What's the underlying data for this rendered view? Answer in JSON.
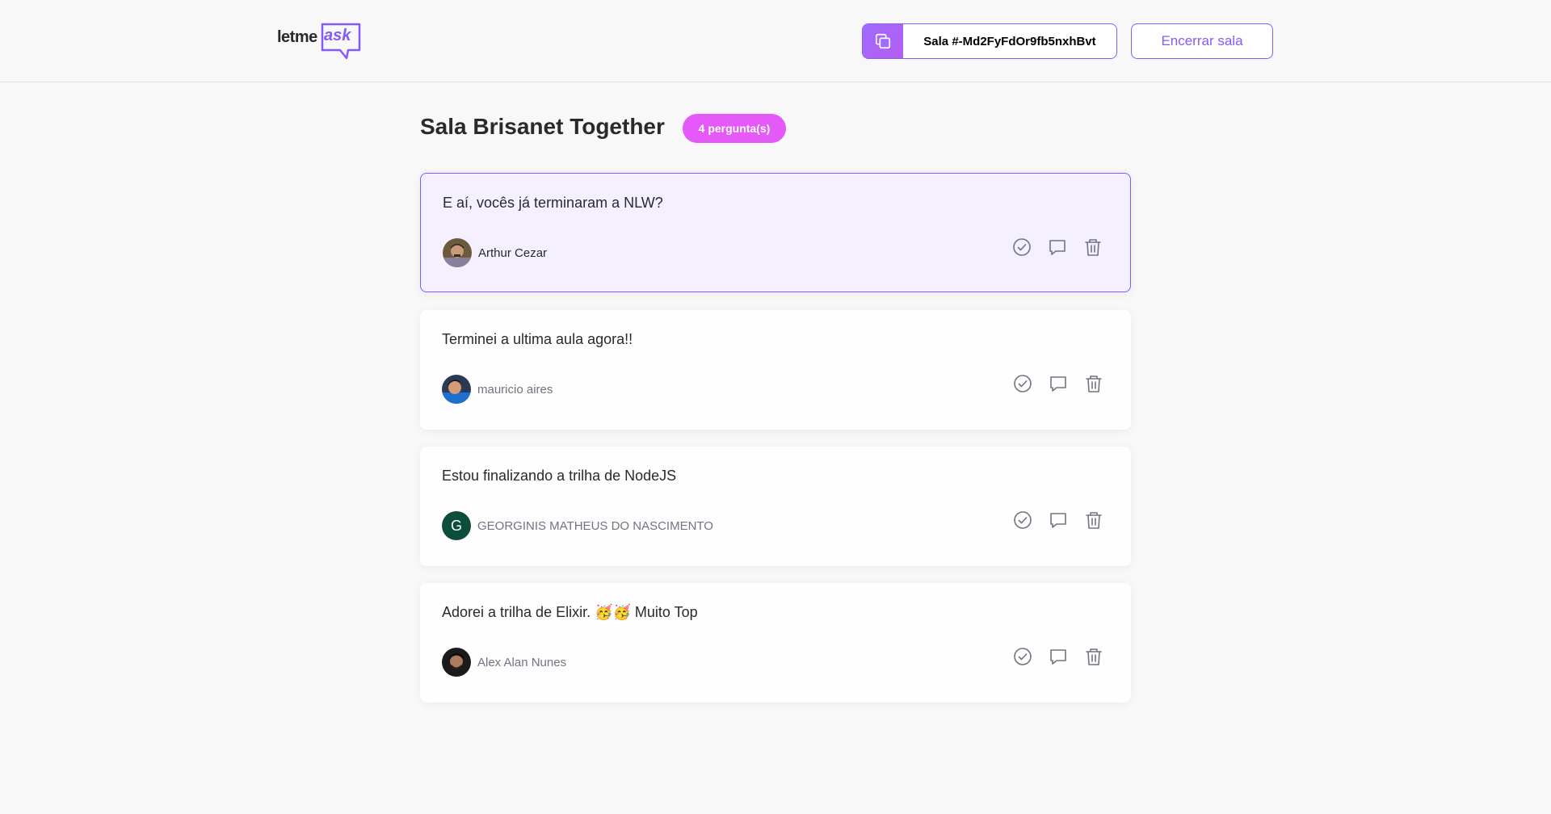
{
  "header": {
    "logo": {
      "part1": "letme",
      "part2": "ask"
    },
    "room_code_label": "Sala #-Md2FyFdOr9fb5nxhBvt",
    "end_room_label": "Encerrar sala"
  },
  "room": {
    "title": "Sala Brisanet Together",
    "question_count_label": "4 pergunta(s)"
  },
  "questions": [
    {
      "content": "E aí, vocês já terminaram a NLW?",
      "author": "Arthur Cezar",
      "highlighted": true,
      "avatar": "photo"
    },
    {
      "content": "Terminei a ultima aula agora!!",
      "author": "mauricio aires",
      "highlighted": false,
      "avatar": "photo"
    },
    {
      "content": "Estou finalizando a trilha de NodeJS",
      "author": "GEORGINIS MATHEUS DO NASCIMENTO",
      "highlighted": false,
      "avatar": "letter",
      "avatar_letter": "G",
      "avatar_color": "#0d4d3c"
    },
    {
      "content": "Adorei a trilha de Elixir. 🥳🥳 Muito Top",
      "author": "Alex Alan Nunes",
      "highlighted": false,
      "avatar": "photo"
    }
  ],
  "icons": {
    "copy": "copy-icon",
    "check": "check-circle-icon",
    "answer": "chat-bubble-icon",
    "delete": "trash-icon"
  },
  "colors": {
    "accent": "#835afd",
    "badge": "#e559f9",
    "highlight_bg": "#f4f0ff"
  }
}
